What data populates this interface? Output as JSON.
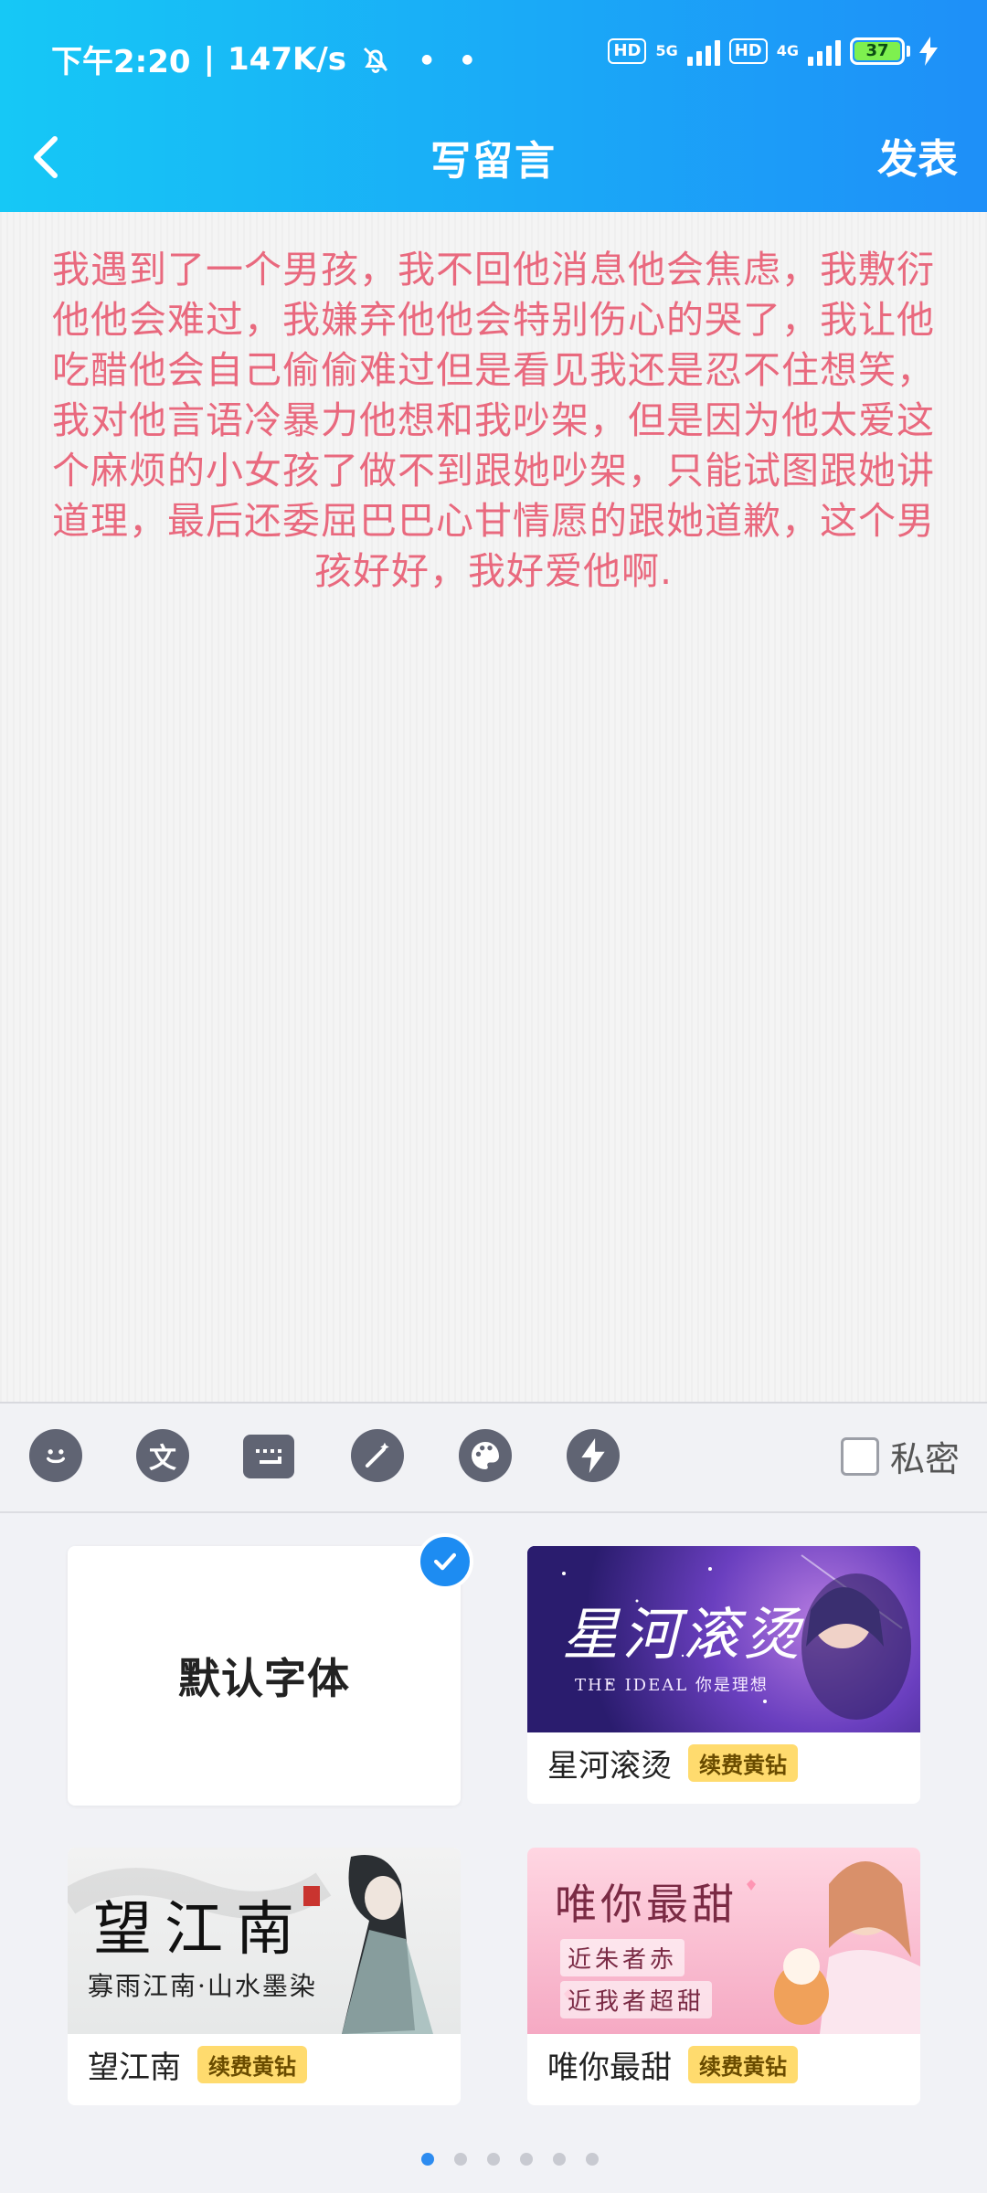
{
  "status_bar": {
    "time": "下午2:20",
    "speed": "147K/s",
    "hd1": "HD",
    "net1": "5G",
    "hd2": "HD",
    "net2": "4G",
    "battery": "37"
  },
  "nav": {
    "title": "写留言",
    "publish_label": "发表"
  },
  "message": {
    "text": "我遇到了一个男孩，我不回他消息他会焦虑，我敷衍他他会难过，我嫌弃他他会特别伤心的哭了，我让他吃醋他会自己偷偷难过但是看见我还是忍不住想笑，我对他言语冷暴力他想和我吵架，但是因为他太爱这个麻烦的小女孩了做不到跟她吵架，只能试图跟她讲道理，最后还委屈巴巴心甘情愿的跟她道歉，这个男孩好好，我好爱他啊."
  },
  "toolbar": {
    "tools": [
      {
        "name": "emoji-icon",
        "glyph": "☺"
      },
      {
        "name": "text-icon",
        "glyph": "文"
      },
      {
        "name": "keyboard-icon",
        "glyph": "⌨"
      },
      {
        "name": "magic-wand-icon",
        "glyph": "✦"
      },
      {
        "name": "palette-icon",
        "glyph": "●"
      },
      {
        "name": "lightning-icon",
        "glyph": "⚡"
      }
    ],
    "private_label": "私密"
  },
  "fonts": {
    "default_label": "默认字体",
    "items": [
      {
        "name": "星河滚烫",
        "tag": "续费黄钻",
        "preview_title": "星河滚烫",
        "preview_sub": "THE IDEAL 你是理想"
      },
      {
        "name": "望江南",
        "tag": "续费黄钻",
        "preview_title": "望江南",
        "preview_sub": "寡雨江南·山水墨染"
      },
      {
        "name": "唯你最甜",
        "tag": "续费黄钻",
        "preview_title": "唯你最甜",
        "preview_sub1": "近朱者赤",
        "preview_sub2": "近我者超甜"
      }
    ]
  },
  "pagination": {
    "count": 6,
    "active": 1
  },
  "colors": {
    "header_start": "#16c8f6",
    "header_end": "#1e8ff8",
    "message_text": "#e9697e",
    "accent": "#1d8cf2",
    "vip_tag": "#ffdb6e"
  }
}
